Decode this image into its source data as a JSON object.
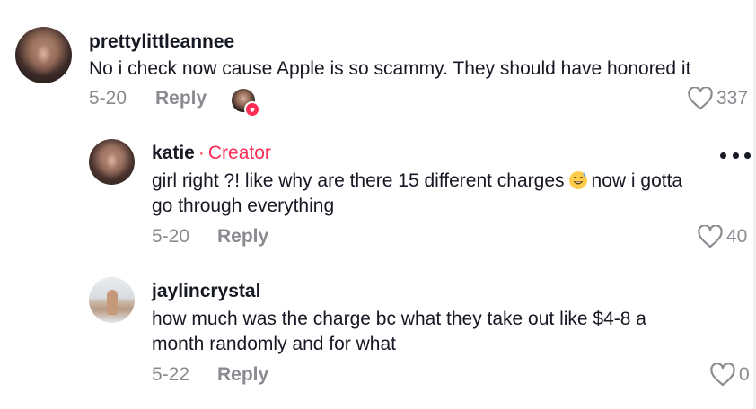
{
  "comments": [
    {
      "username": "prettylittleannee",
      "text": "No i check now cause Apple is so scammy. They should have honored it",
      "date": "5-20",
      "reply_label": "Reply",
      "likes": "337"
    },
    {
      "username": "katie",
      "creator_separator": "·",
      "creator_label": "Creator",
      "text_line1_a": "girl right ?! like why are there 15 different charges",
      "text_line1_b": "now i gotta",
      "text_line2": "go through everything",
      "date": "5-20",
      "reply_label": "Reply",
      "likes": "40"
    },
    {
      "username": "jaylincrystal",
      "text_line1": "how much was the charge bc what they take out like $4-8 a",
      "text_line2": "month randomly and for what",
      "date": "5-22",
      "reply_label": "Reply",
      "likes": "0"
    }
  ],
  "icons": {
    "heart": "heart-outline-icon",
    "more": "more-options-icon",
    "emoji": "sweat-smile-emoji-icon",
    "creator_liked": "creator-liked-heart-icon"
  },
  "colors": {
    "creator_accent": "#fe2c55",
    "muted_text": "#8a8b91",
    "primary_text": "#161823"
  }
}
